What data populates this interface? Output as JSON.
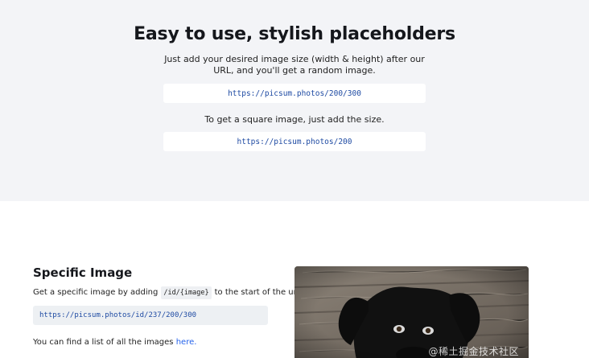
{
  "hero": {
    "title": "Easy to use, stylish placeholders",
    "subtitle": "Just add your desired image size (width & height) after our URL, and you'll get a random image.",
    "url_example": "https://picsum.photos/200/300",
    "square_text": "To get a square image, just add the size.",
    "square_url": "https://picsum.photos/200"
  },
  "specific_image": {
    "title": "Specific Image",
    "desc_prefix": "Get a specific image by adding",
    "desc_code": "/id/{image}",
    "desc_suffix": "to the start of the url.",
    "url": "https://picsum.photos/id/237/200/300",
    "list_prefix": "You can find a list of all the images",
    "list_link": "here."
  },
  "preview": {
    "icon": "dog-photo-image"
  },
  "watermark": {
    "text": "@稀土掘金技术社区"
  }
}
